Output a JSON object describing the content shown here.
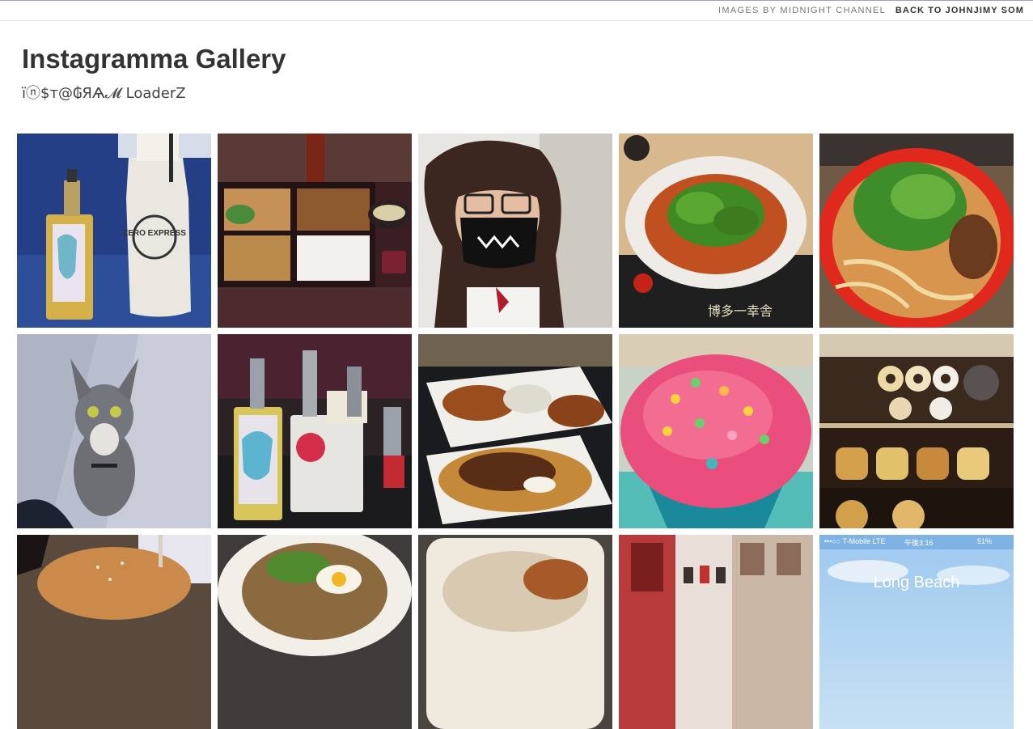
{
  "topbar": {
    "credit": "IMAGES BY MIDNIGHT CHANNEL",
    "back_link": "BACK TO JOHNJIMY SOM"
  },
  "header": {
    "title": "Instagramma Gallery",
    "subtitle": "ïⓝ$т@₲ЯѦ𝓜 LoaderZ"
  },
  "gallery": {
    "tiles": [
      {
        "subject": "vape mod and ZERO EXPRESS milk bottle",
        "bottle_text": "ZERO EXPRESS"
      },
      {
        "subject": "bento box with rice and fried chicken"
      },
      {
        "subject": "selfie with glasses and smiling face mask"
      },
      {
        "subject": "spicy ramen bowl with green onions"
      },
      {
        "subject": "red bowl of ramen with chashu"
      },
      {
        "subject": "grey kitten on sidewalk"
      },
      {
        "subject": "vape mods and tanks on table"
      },
      {
        "subject": "loaded fries and chicken wings"
      },
      {
        "subject": "pink frosted cupcake with sprinkles"
      },
      {
        "subject": "donut bakery display case"
      },
      {
        "subject": "burger with sesame bun"
      },
      {
        "subject": "rice bowl with fried egg"
      },
      {
        "subject": "plate of curry"
      },
      {
        "subject": "chinatown street"
      },
      {
        "subject": "phone screenshot Long Beach",
        "overlay_text": "Long Beach",
        "carrier": "•••○○ T-Mobile  LTE",
        "time": "午後3:16",
        "battery": "51%"
      }
    ]
  }
}
